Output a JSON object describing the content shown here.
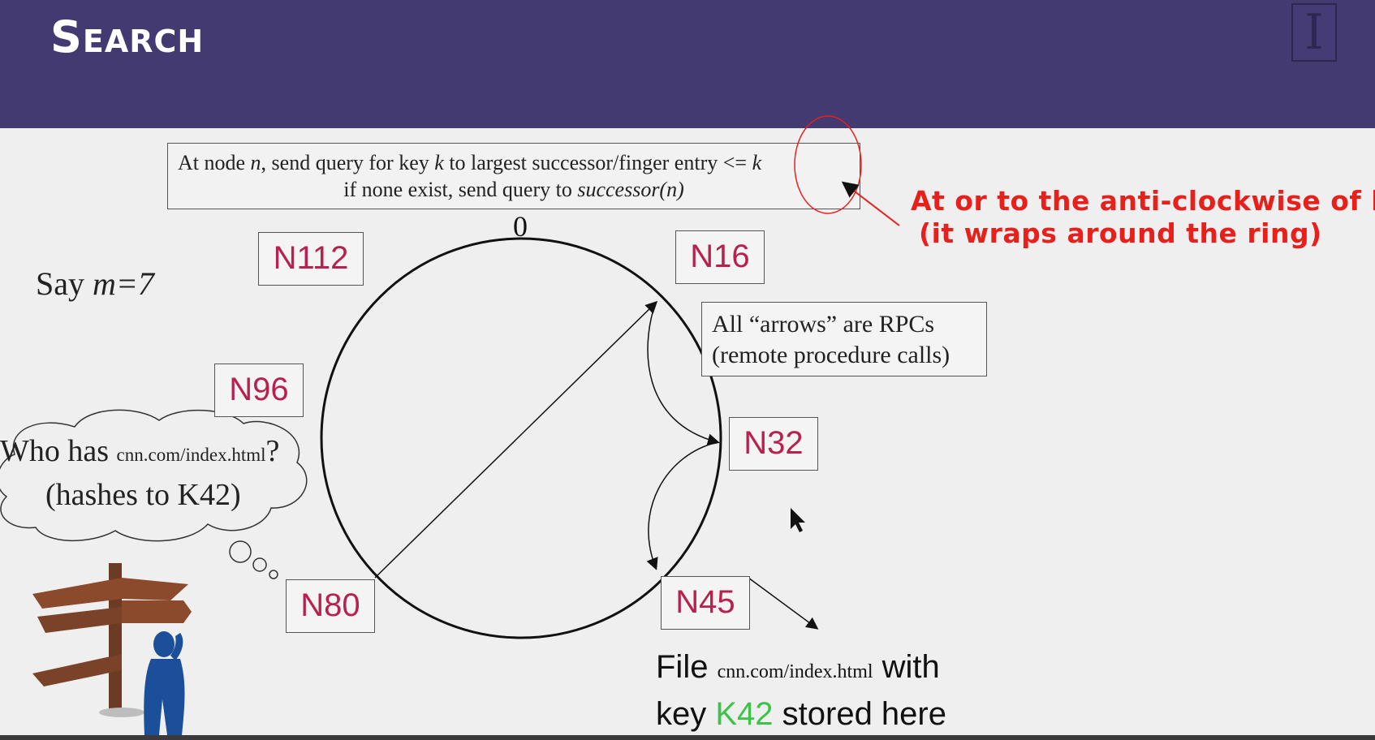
{
  "header": {
    "title": "Search",
    "logo_text": "I"
  },
  "rule": {
    "line1_a": "At node ",
    "line1_n": "n",
    "line1_b": ", send query for key ",
    "line1_k": "k",
    "line1_c": " to largest successor/finger entry <= ",
    "line1_k2": "k",
    "line2_a": "if none exist, send query to ",
    "line2_b": "successor(n)"
  },
  "annotation": {
    "line1": "At or to the anti-clockwise of k",
    "line2": "(it wraps around the ring)",
    "color": "#e8201c"
  },
  "ring": {
    "zero_label": "0",
    "nodes": [
      "N112",
      "N16",
      "N96",
      "N32",
      "N80",
      "N45"
    ],
    "node_color": "#b6224d"
  },
  "say": {
    "prefix": "Say ",
    "expr": "m=7"
  },
  "rpc_note": {
    "line1": "All “arrows” are RPCs",
    "line2": "(remote procedure calls)"
  },
  "thought": {
    "who": "Who has ",
    "url": "cnn.com/index.html",
    "q": "?",
    "hash": "(hashes to K42)"
  },
  "file_note": {
    "a": "File ",
    "url": "cnn.com/index.html",
    "b": " with",
    "c": "key ",
    "key": "K42",
    "d": " stored here",
    "key_color": "#3ec34a"
  }
}
